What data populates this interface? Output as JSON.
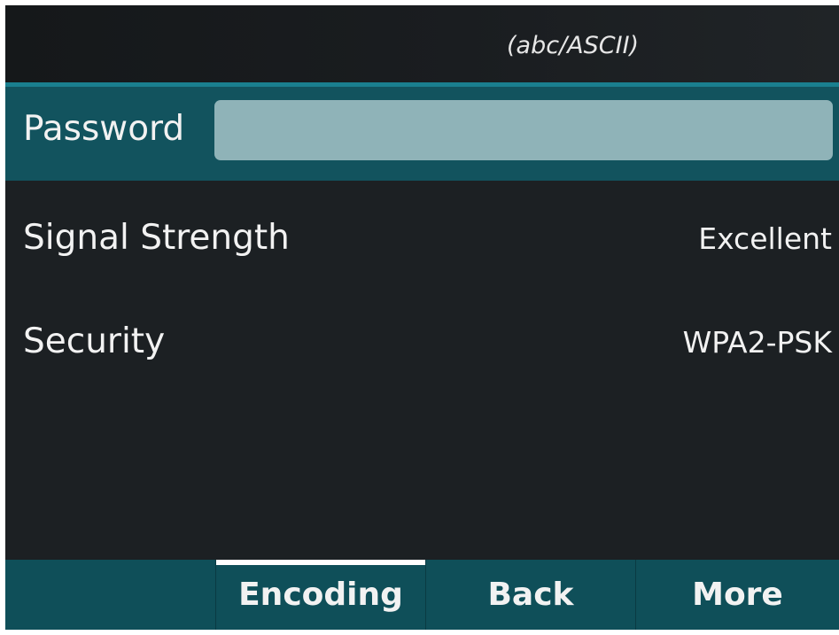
{
  "header": {
    "input_mode_hint": "(abc/ASCII)"
  },
  "password": {
    "label": "Password",
    "value": "",
    "placeholder": ""
  },
  "details": [
    {
      "label": "Signal Strength",
      "value": "Excellent"
    },
    {
      "label": "Security",
      "value": "WPA2-PSK"
    }
  ],
  "softkeys": [
    {
      "label": "",
      "selected": false
    },
    {
      "label": "Encoding",
      "selected": true
    },
    {
      "label": "Back",
      "selected": false
    },
    {
      "label": "More",
      "selected": false
    }
  ],
  "colors": {
    "background": "#1c2023",
    "accent_bar": "#12535e",
    "input_fill": "#8fb3b8",
    "softkey_bar": "#0f4f59",
    "selection_indicator": "#ffffff"
  }
}
